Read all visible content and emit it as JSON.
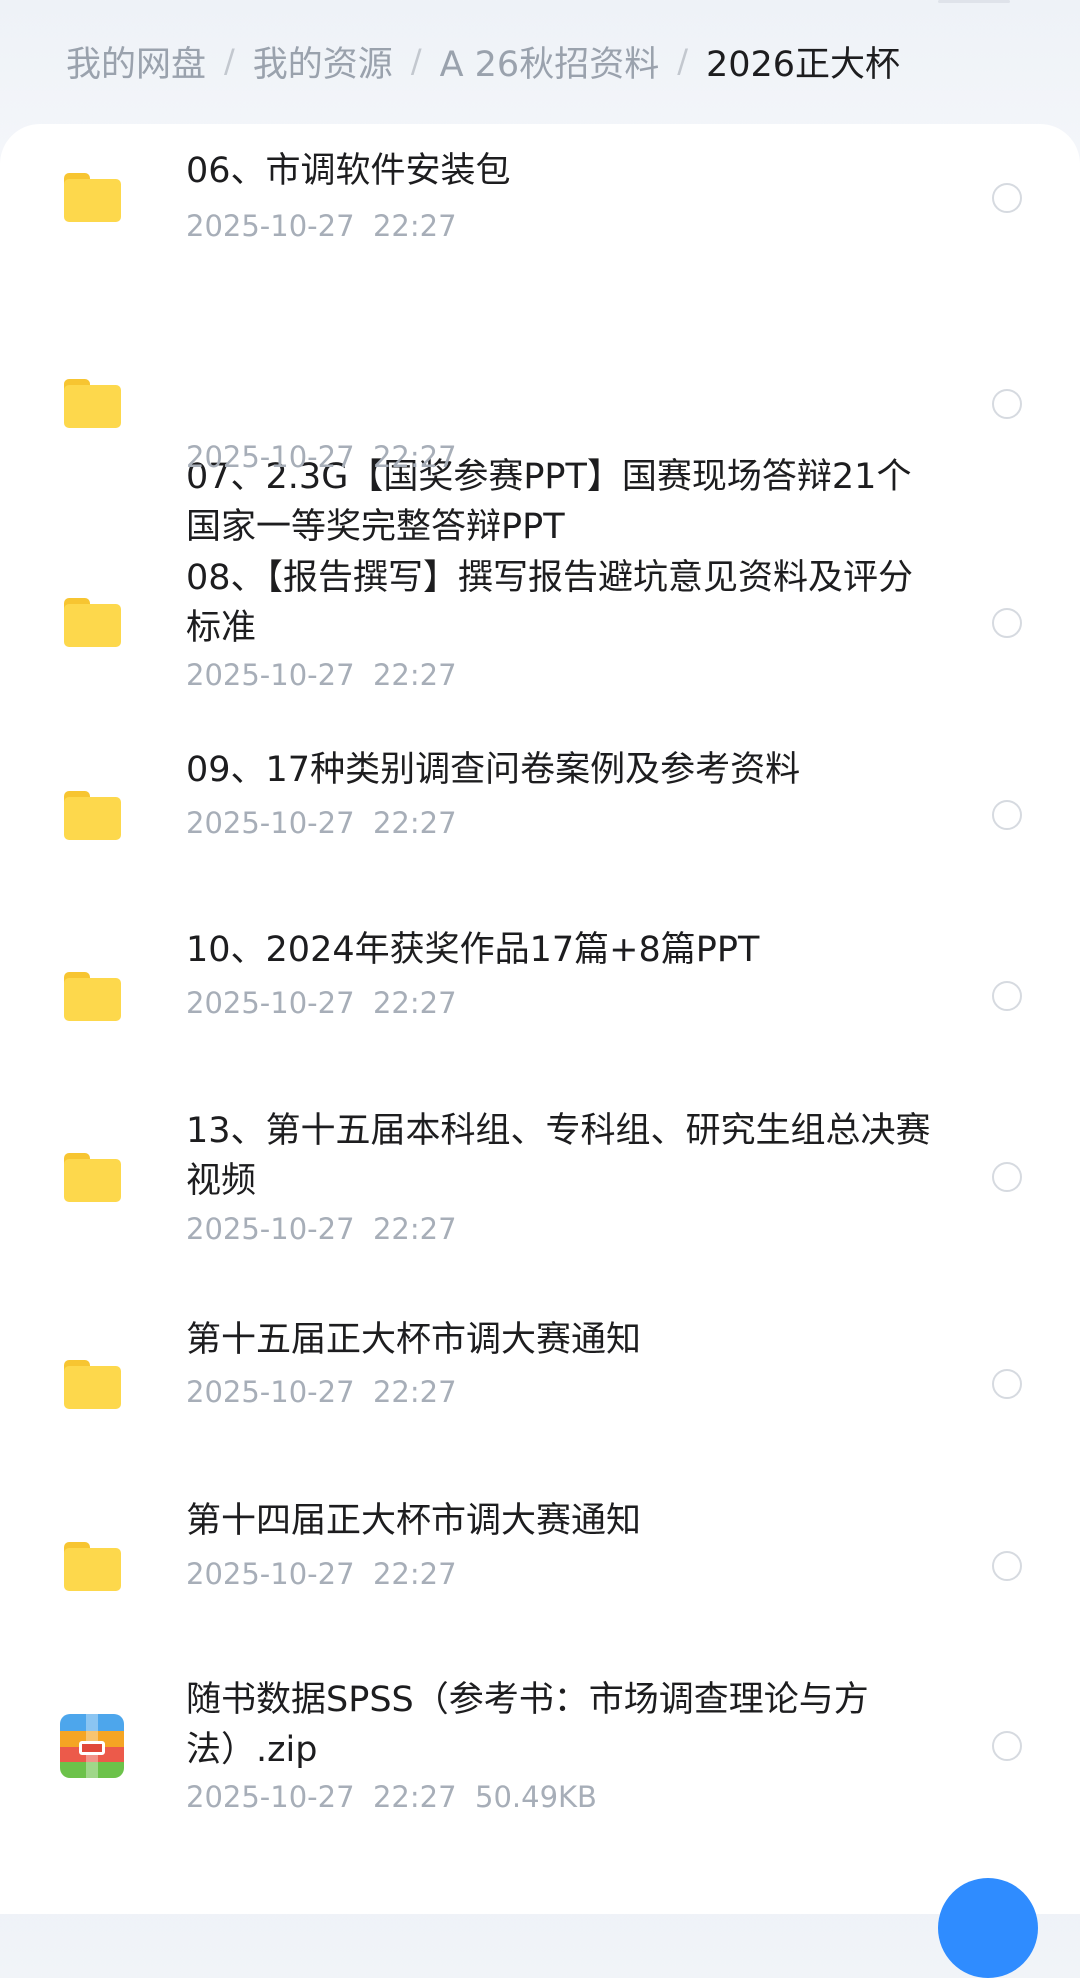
{
  "breadcrumb": [
    {
      "label": "我的网盘"
    },
    {
      "label": "我的资源"
    },
    {
      "label": "A 26秋招资料"
    },
    {
      "label": "2026正大杯"
    }
  ],
  "breadcrumb_separator": "/",
  "files": [
    {
      "type": "folder",
      "icon": "folder-icon",
      "name": "06、市调软件安装包",
      "date": "2025-10-27",
      "time": "22:27",
      "size": ""
    },
    {
      "type": "folder",
      "icon": "folder-icon",
      "name": "07、2.3G【国奖参赛PPT】国赛现场答辩21个国家一等奖完整答辩PPT",
      "date": "2025-10-27",
      "time": "22:27",
      "size": ""
    },
    {
      "type": "folder",
      "icon": "folder-icon",
      "name": "08、【报告撰写】撰写报告避坑意见资料及评分标准",
      "date": "2025-10-27",
      "time": "22:27",
      "size": ""
    },
    {
      "type": "folder",
      "icon": "folder-icon",
      "name": "09、17种类别调查问卷案例及参考资料",
      "date": "2025-10-27",
      "time": "22:27",
      "size": ""
    },
    {
      "type": "folder",
      "icon": "folder-icon",
      "name": "10、2024年获奖作品17篇+8篇PPT",
      "date": "2025-10-27",
      "time": "22:27",
      "size": ""
    },
    {
      "type": "folder",
      "icon": "folder-icon",
      "name": "13、第十五届本科组、专科组、研究生组总决赛视频",
      "date": "2025-10-27",
      "time": "22:27",
      "size": ""
    },
    {
      "type": "folder",
      "icon": "folder-icon",
      "name": "第十五届正大杯市调大赛通知",
      "date": "2025-10-27",
      "time": "22:27",
      "size": ""
    },
    {
      "type": "folder",
      "icon": "folder-icon",
      "name": "第十四届正大杯市调大赛通知",
      "date": "2025-10-27",
      "time": "22:27",
      "size": ""
    },
    {
      "type": "zip",
      "icon": "zip-archive-icon",
      "name": "随书数据SPSS（参考书：市场调查理论与方法）.zip",
      "date": "2025-10-27",
      "time": "22:27",
      "size": "50.49KB"
    }
  ],
  "colors": {
    "folder": "#fdd84c",
    "text_primary": "#1d1d1f",
    "text_secondary": "#a7aeb8",
    "accent": "#2f8cff"
  }
}
